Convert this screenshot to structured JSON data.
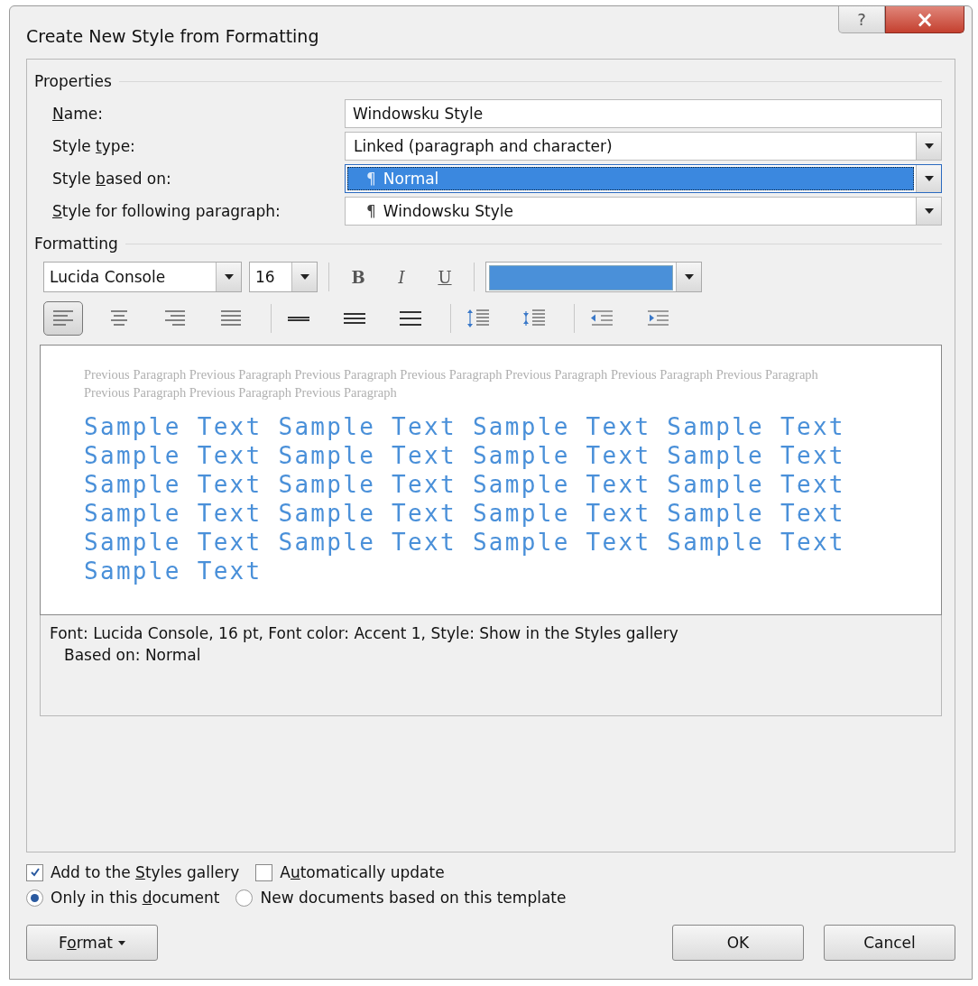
{
  "window": {
    "title": "Create New Style from Formatting",
    "help": "?",
    "close": "×"
  },
  "properties": {
    "heading": "Properties",
    "rows": [
      {
        "kind": "text",
        "label": {
          "key": "N",
          "after": "ame:"
        },
        "value": "Windowsku Style"
      },
      {
        "kind": "select",
        "label": {
          "before": "Style ",
          "key": "t",
          "after": "ype:"
        },
        "value": "Linked (paragraph and character)",
        "selected": false
      },
      {
        "kind": "select",
        "label": {
          "before": "Style ",
          "key": "b",
          "after": "ased on:"
        },
        "value": "Normal",
        "selected": true,
        "pilcrow": "¶"
      },
      {
        "kind": "select",
        "label": {
          "key": "S",
          "after": "tyle for following paragraph:"
        },
        "value": "Windowsku Style",
        "selected": false,
        "pilcrow": "¶"
      }
    ]
  },
  "formatting": {
    "heading": "Formatting",
    "font": "Lucida Console",
    "size": "16",
    "bold": "B",
    "italic": "I",
    "underline": "U",
    "color": "#4a90d9",
    "buttons": [
      {
        "kind": "align-left",
        "selected": true
      },
      {
        "kind": "align-center",
        "selected": false
      },
      {
        "kind": "align-right",
        "selected": false
      },
      {
        "kind": "justify",
        "selected": false
      },
      {
        "kind": "single-spacing",
        "selected": false
      },
      {
        "kind": "one-half-spacing",
        "selected": false
      },
      {
        "kind": "double-spacing",
        "selected": false
      },
      {
        "kind": "space-before",
        "selected": false
      },
      {
        "kind": "space-after",
        "selected": false
      },
      {
        "kind": "outdent",
        "selected": false
      },
      {
        "kind": "indent",
        "selected": false
      }
    ]
  },
  "preview": {
    "previous": "Previous Paragraph Previous Paragraph Previous Paragraph Previous Paragraph Previous Paragraph Previous Paragraph Previous Paragraph Previous Paragraph Previous Paragraph Previous Paragraph",
    "sample": "Sample Text Sample Text Sample Text Sample Text Sample Text Sample Text Sample Text Sample Text Sample Text Sample Text Sample Text Sample Text Sample Text Sample Text Sample Text Sample Text Sample Text Sample Text Sample Text Sample Text Sample Text"
  },
  "description": [
    "Font: Lucida Console, 16 pt, Font color: Accent 1, Style: Show in the Styles gallery",
    "Based on: Normal"
  ],
  "checkboxes": [
    {
      "label": {
        "before": "Add to the ",
        "key": "S",
        "after": "tyles gallery"
      },
      "checked": true
    },
    {
      "label": {
        "before": "A",
        "key": "u",
        "after": "tomatically update"
      },
      "checked": false
    }
  ],
  "radios": [
    {
      "label": {
        "before": "Only in this ",
        "key": "d",
        "after": "ocument"
      },
      "selected": true
    },
    {
      "label": {
        "before": "New documents based on this template"
      },
      "selected": false
    }
  ],
  "buttons": {
    "format": {
      "before": "F",
      "key": "o",
      "after": "rmat"
    },
    "ok": "OK",
    "cancel": "Cancel"
  }
}
